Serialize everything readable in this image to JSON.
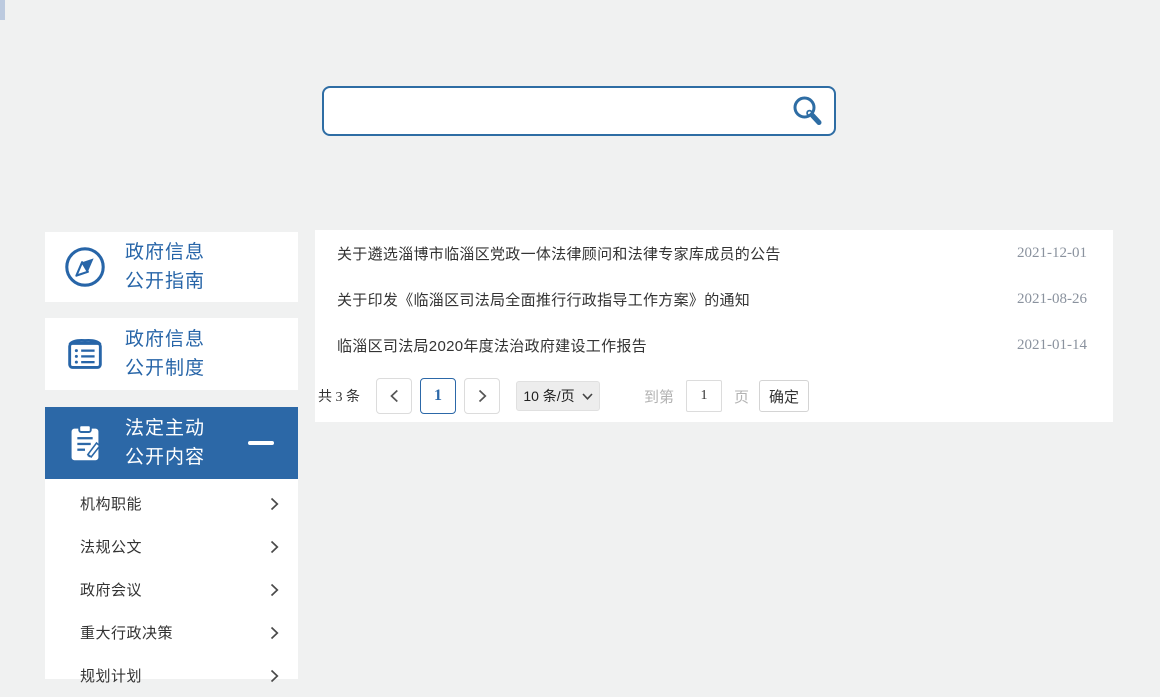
{
  "page": {
    "background": "#f0f1f1",
    "accent_blue": "#2c68a8"
  },
  "search": {
    "placeholder": "",
    "value": "",
    "icon": "search-icon"
  },
  "sidebar": {
    "items": [
      {
        "label_line1": "政府信息",
        "label_line2": "公开指南",
        "icon": "compass-icon",
        "active": false
      },
      {
        "label_line1": "政府信息",
        "label_line2": "公开制度",
        "icon": "document-list-icon",
        "active": false
      },
      {
        "label_line1": "法定主动",
        "label_line2": "公开内容",
        "icon": "clipboard-pencil-icon",
        "active": true,
        "state_icon": "minus-icon"
      }
    ],
    "submenu": [
      {
        "label": "机构职能",
        "icon": "chevron-right-icon"
      },
      {
        "label": "法规公文",
        "icon": "chevron-right-icon"
      },
      {
        "label": "政府会议",
        "icon": "chevron-right-icon"
      },
      {
        "label": "重大行政决策",
        "icon": "chevron-right-icon"
      },
      {
        "label": "规划计划",
        "icon": "chevron-right-icon"
      }
    ]
  },
  "articles": [
    {
      "title": "关于遴选淄博市临淄区党政一体法律顾问和法律专家库成员的公告",
      "date": "2021-12-01"
    },
    {
      "title": "关于印发《临淄区司法局全面推行行政指导工作方案》的通知",
      "date": "2021-08-26"
    },
    {
      "title": "临淄区司法局2020年度法治政府建设工作报告",
      "date": "2021-01-14"
    }
  ],
  "pagination": {
    "total_label": "共 3 条",
    "current_page": "1",
    "page_size": "10 条/页",
    "goto_prefix": "到第",
    "goto_value": "1",
    "goto_suffix": "页",
    "confirm_label": "确定"
  }
}
